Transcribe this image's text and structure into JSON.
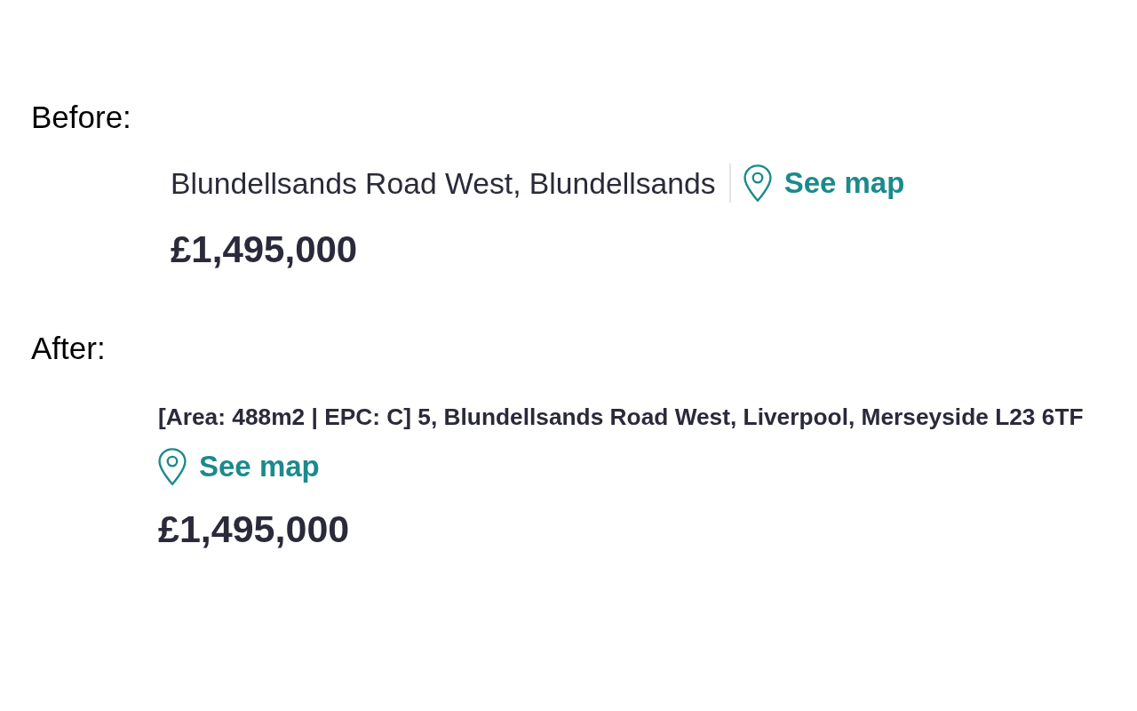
{
  "sections": [
    {
      "heading": "Before:",
      "kind": "inline",
      "address": "Blundellsands Road West, Blundellsands",
      "map_link": "See map",
      "price": "£1,495,000"
    },
    {
      "heading": "After:",
      "kind": "stacked",
      "address": "[Area: 488m2 | EPC: C] 5, Blundellsands Road West, Liverpool, Merseyside L23 6TF",
      "map_link": "See map",
      "price": "£1,495,000"
    }
  ]
}
